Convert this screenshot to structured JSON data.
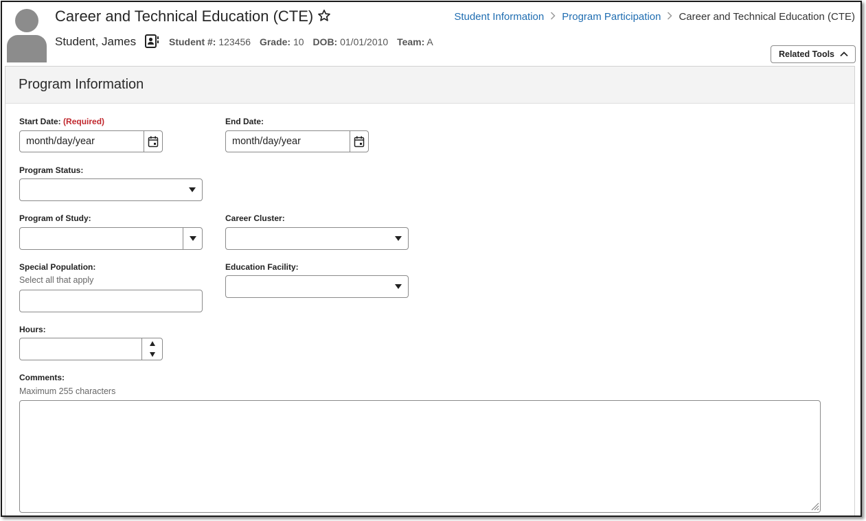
{
  "header": {
    "title": "Career and Technical Education (CTE)",
    "student_name": "Student, James",
    "meta": [
      {
        "label": "Student #:",
        "value": "123456"
      },
      {
        "label": "Grade:",
        "value": "10"
      },
      {
        "label": "DOB:",
        "value": "01/01/2010"
      },
      {
        "label": "Team:",
        "value": "A"
      }
    ],
    "related_tools_label": "Related Tools"
  },
  "breadcrumb": {
    "items": [
      "Student Information",
      "Program Participation",
      "Career and Technical Education (CTE)"
    ]
  },
  "panel": {
    "title": "Program Information"
  },
  "form": {
    "start_date": {
      "label": "Start Date:",
      "required_label": "(Required)",
      "placeholder": "month/day/year"
    },
    "end_date": {
      "label": "End Date:",
      "placeholder": "month/day/year"
    },
    "program_status": {
      "label": "Program Status:",
      "value": ""
    },
    "program_of_study": {
      "label": "Program of Study:",
      "value": ""
    },
    "career_cluster": {
      "label": "Career Cluster:",
      "value": ""
    },
    "special_population": {
      "label": "Special Population:",
      "hint": "Select all that apply",
      "value": ""
    },
    "education_facility": {
      "label": "Education Facility:",
      "value": ""
    },
    "hours": {
      "label": "Hours:",
      "value": ""
    },
    "comments": {
      "label": "Comments:",
      "hint": "Maximum 255 characters",
      "value": ""
    }
  },
  "icons": {
    "favorite": "star-outline-icon",
    "contact": "contact-card-icon",
    "calendar": "calendar-icon",
    "chevron": "chevron-up-icon"
  },
  "colors": {
    "link": "#1f6db1",
    "required": "#c0272d",
    "panel_header_bg": "#f3f3f3",
    "avatar": "#8c8c8c"
  }
}
